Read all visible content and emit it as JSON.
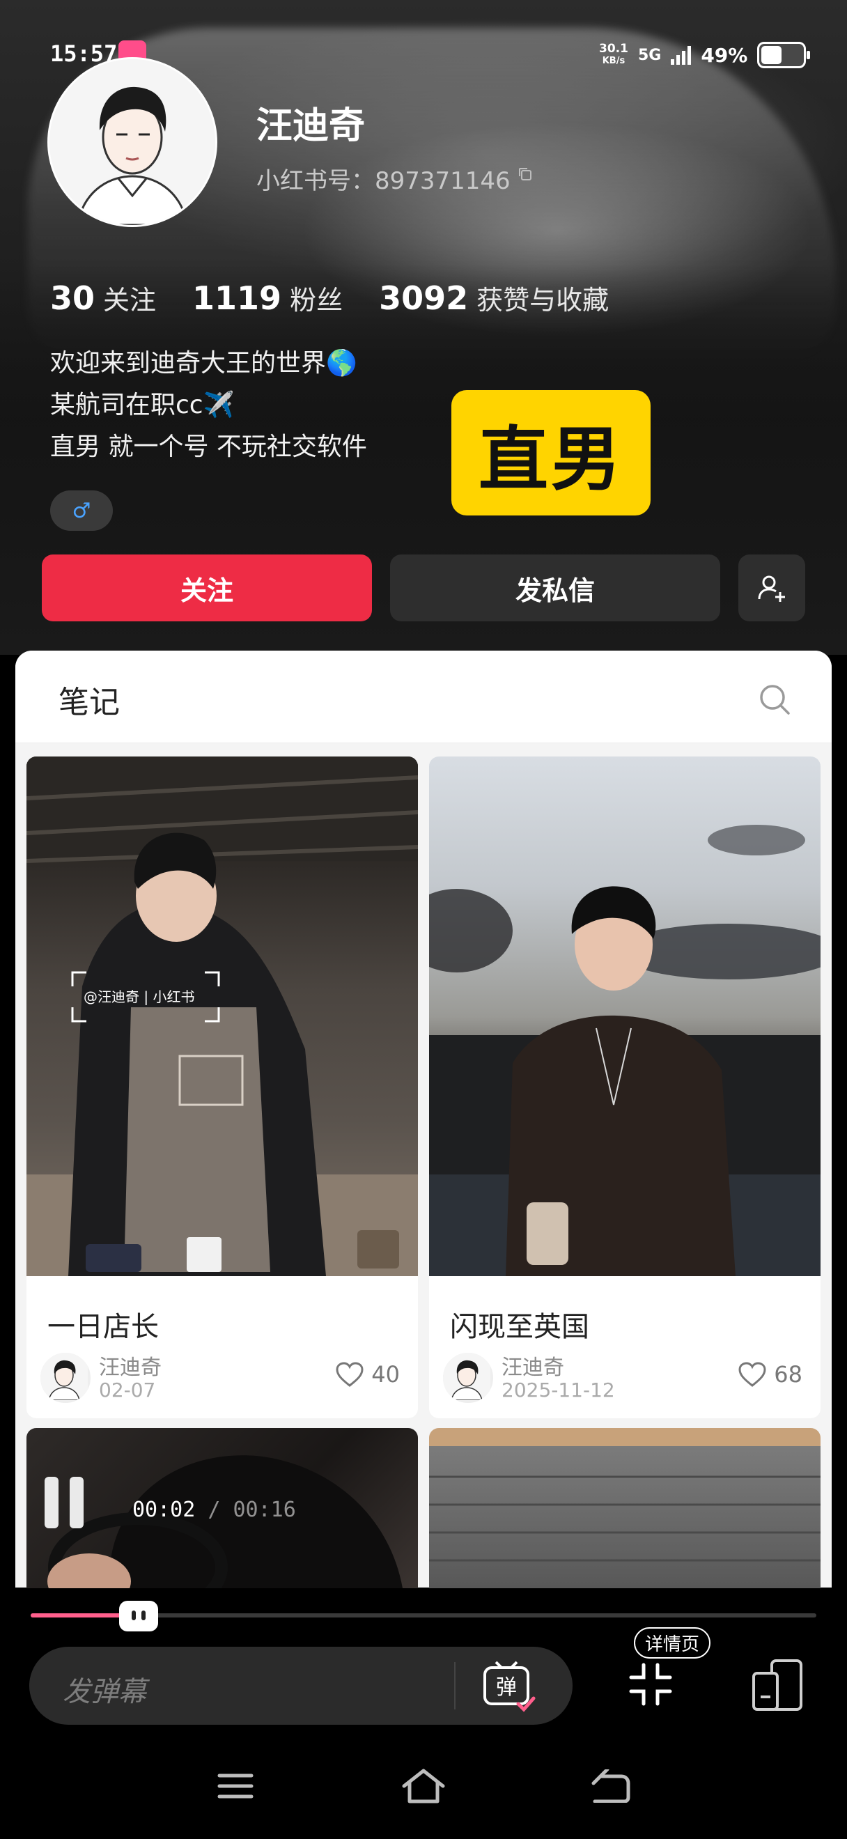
{
  "status_bar": {
    "time": "15:57",
    "speed_value": "30.1",
    "speed_unit": "KB/s",
    "network": "5G",
    "battery": "49%",
    "battery_level": 0.49
  },
  "profile": {
    "name": "汪迪奇",
    "id_text": "小红书号：897371146",
    "stats": [
      {
        "value": "30",
        "label": "关注"
      },
      {
        "value": "1119",
        "label": "粉丝"
      },
      {
        "value": "3092",
        "label": "获赞与收藏"
      }
    ],
    "bio": [
      "欢迎来到迪奇大王的世界🌎",
      "某航司在职cc✈️",
      "直男 就一个号 不玩社交软件"
    ],
    "sticker_text": "直男",
    "gender_symbol": "♂"
  },
  "actions": {
    "follow_label": "关注",
    "message_label": "发私信"
  },
  "notes": {
    "section_title": "笔记",
    "cards": [
      {
        "title": "一日店长",
        "author": "汪迪奇",
        "date": "02-07",
        "likes": "40",
        "watermark": "@汪迪奇 | 小红书"
      },
      {
        "title": "闪现至英国",
        "author": "汪迪奇",
        "date": "2025-11-12",
        "likes": "68"
      }
    ]
  },
  "player": {
    "current_time": "00:02",
    "total_time": "00:16",
    "progress": 0.125,
    "danmaku_placeholder": "发弹幕",
    "danmaku_icon_label": "弹",
    "detail_label": "详情页",
    "accent_color": "#ff5f8c"
  },
  "colors": {
    "follow_button": "#ee2c45",
    "sticker": "#ffd400"
  }
}
